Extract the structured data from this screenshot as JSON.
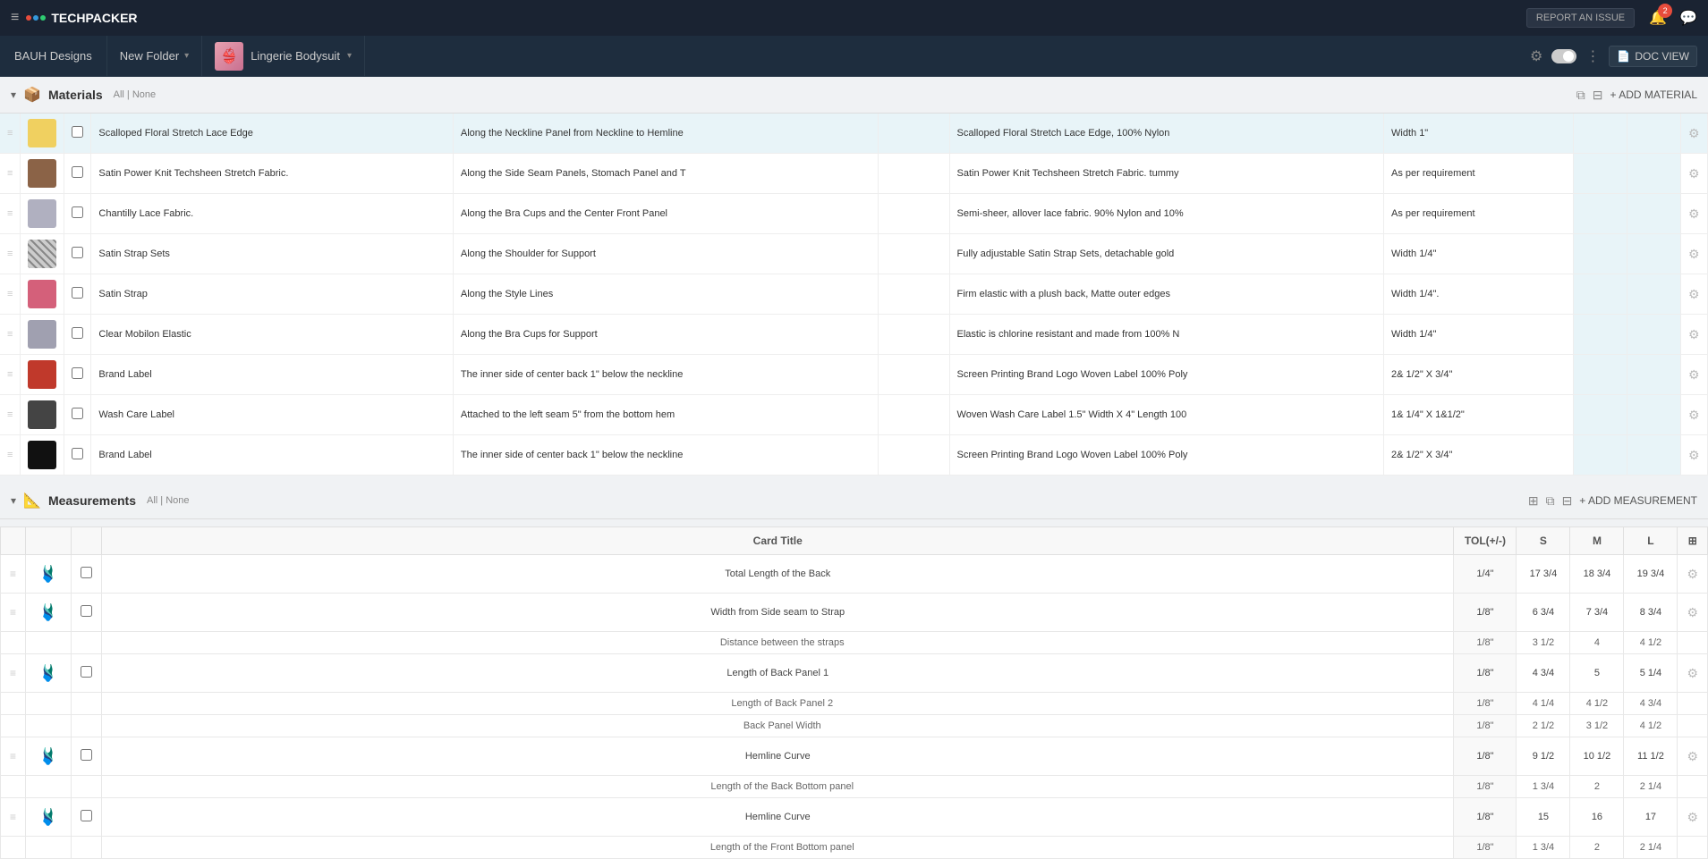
{
  "topNav": {
    "hamburger": "≡",
    "brandDots": [
      "#e74c3c",
      "#3498db",
      "#2ecc71",
      "#f39c12",
      "#9b59b6",
      "#1abc9c"
    ],
    "brandName": "TECHPACKER",
    "reportIssue": "REPORT AN ISSUE",
    "notifCount": "2",
    "bellIcon": "🔔",
    "chatIcon": "💬"
  },
  "secNav": {
    "brandTab": "BAUH Designs",
    "folderTab": "New Folder",
    "productTab": "Lingerie Bodysuit",
    "settingsIcon": "⚙",
    "dotsIcon": "⋮",
    "docViewLabel": "DOC VIEW"
  },
  "materials": {
    "title": "Materials",
    "allLabel": "All",
    "noneLabel": "None",
    "addButtonLabel": "+ ADD MATERIAL",
    "rows": [
      {
        "name": "Scalloped Floral Stretch Lace Edge",
        "placement": "Along the Neckline Panel from Neckline to Hemline",
        "description": "Scalloped Floral Stretch Lace Edge, 100% Nylon",
        "width": "Width 1\"",
        "thumbType": "yellow",
        "highlighted": true
      },
      {
        "name": "Satin Power Knit Techsheen Stretch Fabric.",
        "placement": "Along the Side Seam Panels, Stomach Panel and T",
        "description": "Satin Power Knit Techsheen Stretch Fabric. tummy",
        "width": "As per requirement",
        "thumbType": "brown",
        "highlighted": false
      },
      {
        "name": "Chantilly Lace Fabric.",
        "placement": "Along the Bra Cups and the Center Front Panel",
        "description": "Semi-sheer, allover lace fabric. 90% Nylon and 10%",
        "width": "As per requirement",
        "thumbType": "gray",
        "highlighted": false
      },
      {
        "name": "Satin Strap Sets",
        "placement": "Along the Shoulder for Support",
        "description": "Fully adjustable Satin Strap Sets, detachable gold",
        "width": "Width 1/4\"",
        "thumbType": "stripe",
        "highlighted": false
      },
      {
        "name": "Satin Strap",
        "placement": "Along the Style Lines",
        "description": "Firm elastic with a plush back, Matte outer edges",
        "width": "Width 1/4\".",
        "thumbType": "pink",
        "highlighted": false
      },
      {
        "name": "Clear Mobilon Elastic",
        "placement": "Along the Bra Cups for Support",
        "description": "Elastic is chlorine resistant and made from 100% N",
        "width": "Width 1/4\"",
        "thumbType": "gray2",
        "highlighted": false
      },
      {
        "name": "Brand Label",
        "placement": "The inner side of center back 1\" below the neckline",
        "description": "Screen Printing Brand Logo Woven Label 100% Poly",
        "width": "2& 1/2\"  X 3/4\"",
        "thumbType": "red",
        "highlighted": false
      },
      {
        "name": "Wash Care Label",
        "placement": "Attached to the left seam 5\" from the bottom hem",
        "description": "Woven Wash Care Label 1.5\" Width X 4\" Length 100",
        "width": "1& 1/4\" X 1&1/2\"",
        "thumbType": "dark",
        "highlighted": false
      },
      {
        "name": "Brand Label",
        "placement": "The inner side of center back 1\" below the neckline",
        "description": "Screen Printing Brand Logo Woven Label 100% Poly",
        "width": "2& 1/2\"  X 3/4\"",
        "thumbType": "black",
        "highlighted": false
      }
    ]
  },
  "measurements": {
    "title": "Measurements",
    "allLabel": "All",
    "noneLabel": "None",
    "addButtonLabel": "+ ADD MEASUREMENT",
    "columns": {
      "cardTitle": "Card Title",
      "tol": "TOL(+/-)",
      "s": "S",
      "m": "M",
      "l": "L"
    },
    "rows": [
      {
        "name": "Total Length of the Back",
        "tol": "1/4\"",
        "s": "17 3/4",
        "m": "18 3/4",
        "l": "19 3/4",
        "hasCheckbox": true,
        "hasDrag": true,
        "hasThumb": true,
        "subRows": []
      },
      {
        "name": "Width from Side seam to Strap",
        "tol": "1/8\"",
        "s": "6 3/4",
        "m": "7 3/4",
        "l": "8 3/4",
        "hasCheckbox": true,
        "hasDrag": true,
        "hasThumb": true,
        "subRows": [
          {
            "name": "Distance between the straps",
            "tol": "1/8\"",
            "s": "3 1/2",
            "m": "4",
            "l": "4 1/2"
          }
        ]
      },
      {
        "name": "Length of Back Panel 1",
        "tol": "1/8\"",
        "s": "4 3/4",
        "m": "5",
        "l": "5 1/4",
        "hasCheckbox": true,
        "hasDrag": true,
        "hasThumb": true,
        "subRows": [
          {
            "name": "Length of Back Panel 2",
            "tol": "1/8\"",
            "s": "4 1/4",
            "m": "4 1/2",
            "l": "4 3/4"
          },
          {
            "name": "Back Panel Width",
            "tol": "1/8\"",
            "s": "2 1/2",
            "m": "3 1/2",
            "l": "4 1/2"
          }
        ]
      },
      {
        "name": "Hemline Curve",
        "tol": "1/8\"",
        "s": "9 1/2",
        "m": "10 1/2",
        "l": "11 1/2",
        "hasCheckbox": true,
        "hasDrag": true,
        "hasThumb": true,
        "subRows": [
          {
            "name": "Length of the Back Bottom panel",
            "tol": "1/8\"",
            "s": "1 3/4",
            "m": "2",
            "l": "2 1/4"
          }
        ]
      },
      {
        "name": "Hemline Curve",
        "tol": "1/8\"",
        "s": "15",
        "m": "16",
        "l": "17",
        "hasCheckbox": true,
        "hasDrag": true,
        "hasThumb": true,
        "subRows": [
          {
            "name": "Length of the Front Bottom panel",
            "tol": "1/8\"",
            "s": "1 3/4",
            "m": "2",
            "l": "2 1/4"
          }
        ]
      }
    ]
  }
}
